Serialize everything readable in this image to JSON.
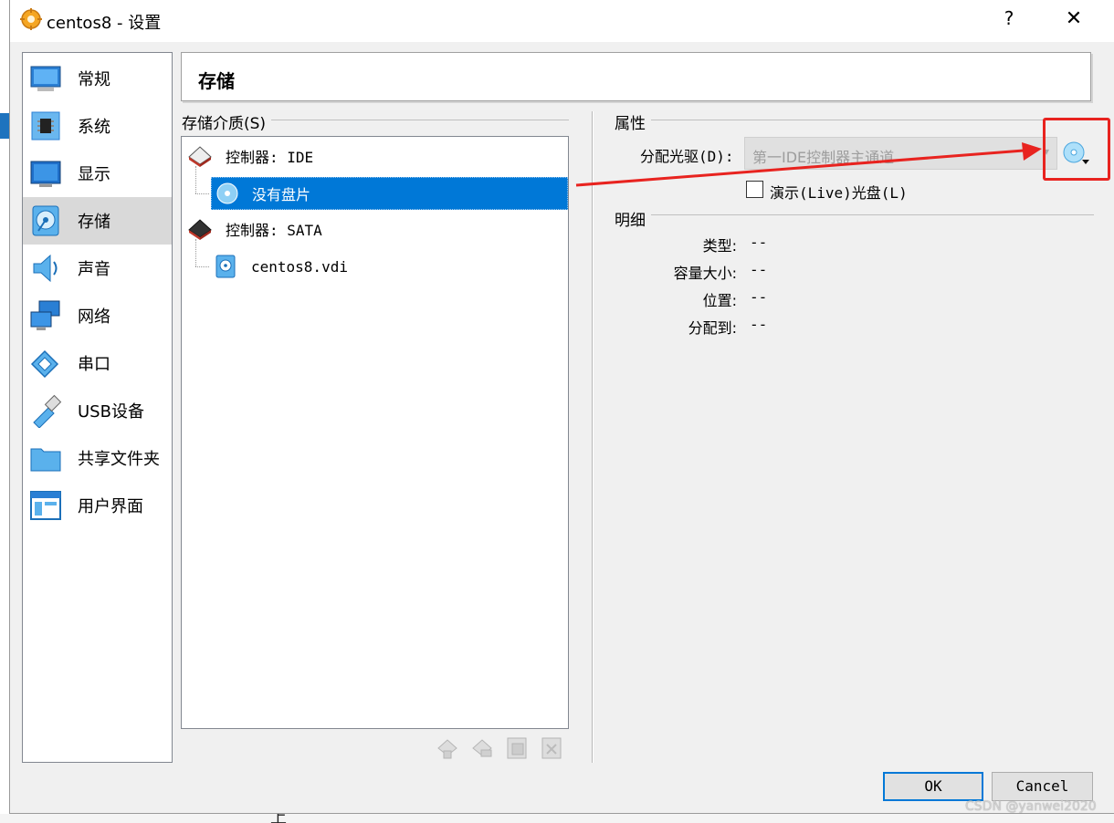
{
  "window": {
    "title": "centos8 - 设置",
    "help": "?",
    "close": "✕"
  },
  "sidebar": {
    "items": [
      {
        "label": "常规",
        "icon": "general-icon"
      },
      {
        "label": "系统",
        "icon": "system-chip-icon"
      },
      {
        "label": "显示",
        "icon": "display-monitor-icon"
      },
      {
        "label": "存储",
        "icon": "storage-disk-icon",
        "active": true
      },
      {
        "label": "声音",
        "icon": "audio-speaker-icon"
      },
      {
        "label": "网络",
        "icon": "network-icon"
      },
      {
        "label": "串口",
        "icon": "serial-port-icon"
      },
      {
        "label": "USB设备",
        "icon": "usb-icon"
      },
      {
        "label": "共享文件夹",
        "icon": "shared-folder-icon"
      },
      {
        "label": "用户界面",
        "icon": "user-interface-icon"
      }
    ]
  },
  "header": {
    "title": "存储"
  },
  "storage_media": {
    "label": "存储介质(S)",
    "tree": [
      {
        "label": "控制器: IDE",
        "icon": "ide-controller-icon",
        "level": 0
      },
      {
        "label": "没有盘片",
        "icon": "optical-disc-icon",
        "level": 1,
        "selected": true
      },
      {
        "label": "控制器: SATA",
        "icon": "sata-controller-icon",
        "level": 0
      },
      {
        "label": "centos8.vdi",
        "icon": "hard-disk-icon",
        "level": 1
      }
    ]
  },
  "properties": {
    "label": "属性",
    "optical_drive_label": "分配光驱(D):",
    "optical_drive_value": "第一IDE控制器主通道",
    "live_cd_label": "演示(Live)光盘(L)"
  },
  "details": {
    "label": "明细",
    "rows": [
      {
        "key": "类型:",
        "value": "--"
      },
      {
        "key": "容量大小:",
        "value": "--"
      },
      {
        "key": "位置:",
        "value": "--"
      },
      {
        "key": "分配到:",
        "value": "--"
      }
    ]
  },
  "buttons": {
    "ok": "OK",
    "cancel": "Cancel"
  },
  "watermark": "CSDN @yanwei2020",
  "colors": {
    "selection": "#0078d7",
    "annotation": "#e8231f"
  }
}
